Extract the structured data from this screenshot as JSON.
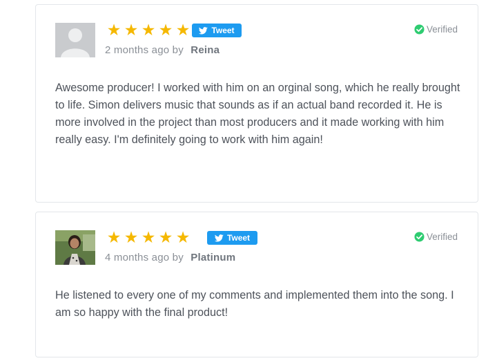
{
  "reviews": [
    {
      "rating": 5,
      "tweet_label": "Tweet",
      "verified_label": "Verified",
      "time_ago": "2 months ago",
      "by_label": "by",
      "author": "Reina",
      "avatar": "default-user-silhouette",
      "text": "Awesome producer! I worked with him on an orginal song, which he really brought to life. Simon delivers music that sounds as if an actual band recorded it. He is more involved in the project than most producers and it made working with him really easy. I'm definitely going to work with him again!"
    },
    {
      "rating": 5,
      "tweet_label": "Tweet",
      "verified_label": "Verified",
      "time_ago": "4 months ago",
      "by_label": "by",
      "author": "Platinum",
      "avatar": "user-photo",
      "text": "He listened to every one of my comments and implemented them into the song. I am so happy with the final product!"
    }
  ],
  "colors": {
    "star": "#f5b800",
    "tweet_button": "#1d9bf0",
    "verified_check": "#2ecc71",
    "border": "#e3e6ea"
  },
  "icons": {
    "star": "star-icon",
    "twitter": "twitter-bird-icon",
    "verified": "check-circle-icon"
  }
}
